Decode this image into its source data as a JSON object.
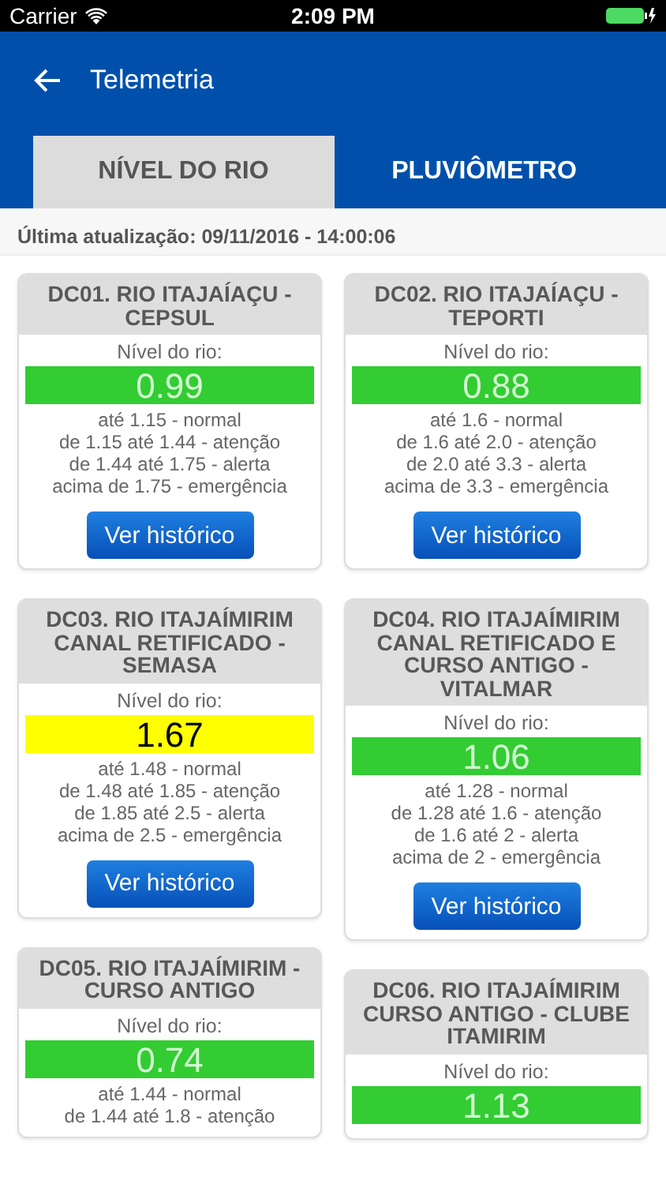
{
  "status_bar": {
    "carrier": "Carrier",
    "time": "2:09 PM"
  },
  "header": {
    "title": "Telemetria"
  },
  "tabs": [
    {
      "label": "NÍVEL DO RIO",
      "selected": true
    },
    {
      "label": "PLUVIÔMETRO",
      "selected": false
    }
  ],
  "last_update": "Última atualização: 09/11/2016 - 14:00:06",
  "columns": [
    {
      "stations": [
        {
          "title": "DC01. RIO ITAJAÍAÇU - CEPSUL",
          "level_label": "Nível do rio:",
          "value": "0.99",
          "color": "#33cc33",
          "thresholds": [
            "até 1.15 - normal",
            "de 1.15 até 1.44 - atenção",
            "de 1.44 até 1.75 - alerta",
            "acima de 1.75 - emergência"
          ],
          "button": "Ver histórico"
        },
        {
          "title": "DC03. RIO ITAJAÍMIRIM CANAL RETIFICADO - SEMASA",
          "level_label": "Nível do rio:",
          "value": "1.67",
          "color": "#ffff00",
          "thresholds": [
            "até 1.48 - normal",
            "de 1.48 até 1.85 - atenção",
            "de 1.85 até 2.5 - alerta",
            "acima de 2.5 - emergência"
          ],
          "button": "Ver histórico"
        },
        {
          "title": "DC05. RIO ITAJAÍMIRIM - CURSO ANTIGO",
          "level_label": "Nível do rio:",
          "value": "0.74",
          "color": "#33cc33",
          "thresholds": [
            "até 1.44 - normal",
            "de 1.44 até 1.8 - atenção"
          ]
        }
      ]
    },
    {
      "stations": [
        {
          "title": "DC02. RIO ITAJAÍAÇU - TEPORTI",
          "level_label": "Nível do rio:",
          "value": "0.88",
          "color": "#33cc33",
          "thresholds": [
            "até 1.6 - normal",
            "de 1.6 até 2.0 - atenção",
            "de 2.0 até 3.3 - alerta",
            "acima de 3.3 - emergência"
          ],
          "button": "Ver histórico"
        },
        {
          "title": "DC04. RIO ITAJAÍMIRIM CANAL RETIFICADO E CURSO ANTIGO - VITALMAR",
          "level_label": "Nível do rio:",
          "value": "1.06",
          "color": "#33cc33",
          "thresholds": [
            "até 1.28 - normal",
            "de 1.28 até 1.6 - atenção",
            "de 1.6 até 2 - alerta",
            "acima de 2 - emergência"
          ],
          "button": "Ver histórico"
        },
        {
          "title": "DC06. RIO ITAJAÍMIRIM CURSO ANTIGO - CLUBE ITAMIRIM",
          "level_label": "Nível do rio:",
          "value": "1.13",
          "color": "#33cc33"
        }
      ]
    }
  ]
}
